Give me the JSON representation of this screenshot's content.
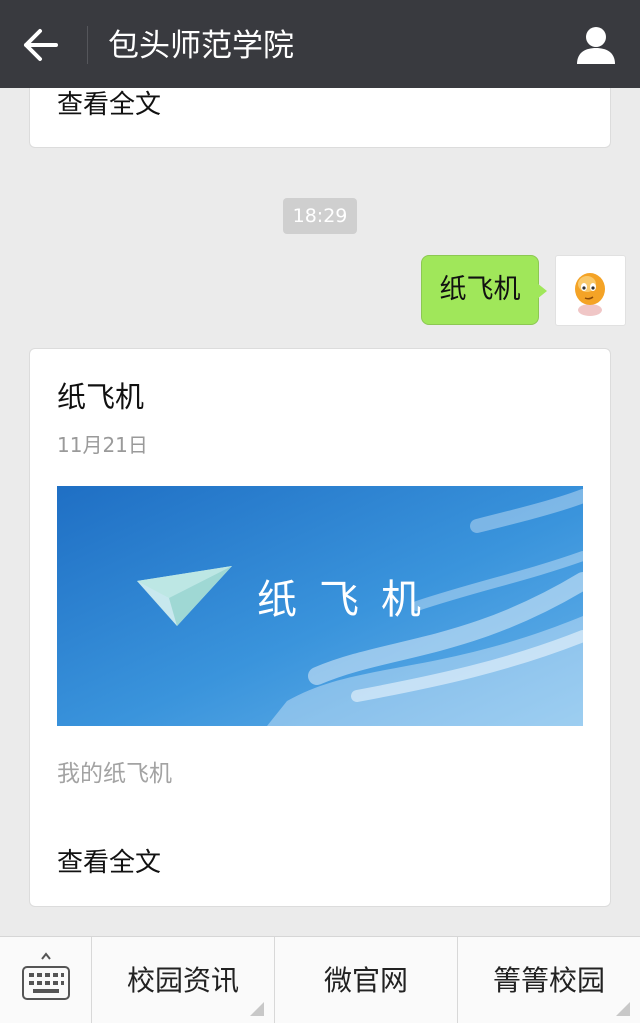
{
  "header": {
    "title": "包头师范学院"
  },
  "previous_card": {
    "read_more": "查看全文"
  },
  "timestamp": "18:29",
  "outgoing_message": {
    "text": "纸飞机"
  },
  "article": {
    "title": "纸飞机",
    "date": "11月21日",
    "cover_text": "纸飞机",
    "description": "我的纸飞机",
    "read_more": "查看全文"
  },
  "bottom_menu": {
    "items": [
      {
        "label": "校园资讯"
      },
      {
        "label": "微官网"
      },
      {
        "label": "箐箐校园"
      }
    ]
  },
  "icons": {
    "back": "arrow-left-icon",
    "profile": "person-icon",
    "keyboard": "keyboard-icon"
  },
  "colors": {
    "header_bg": "#393a3f",
    "bubble_bg": "#a0e75a",
    "page_bg": "#ebebeb"
  }
}
